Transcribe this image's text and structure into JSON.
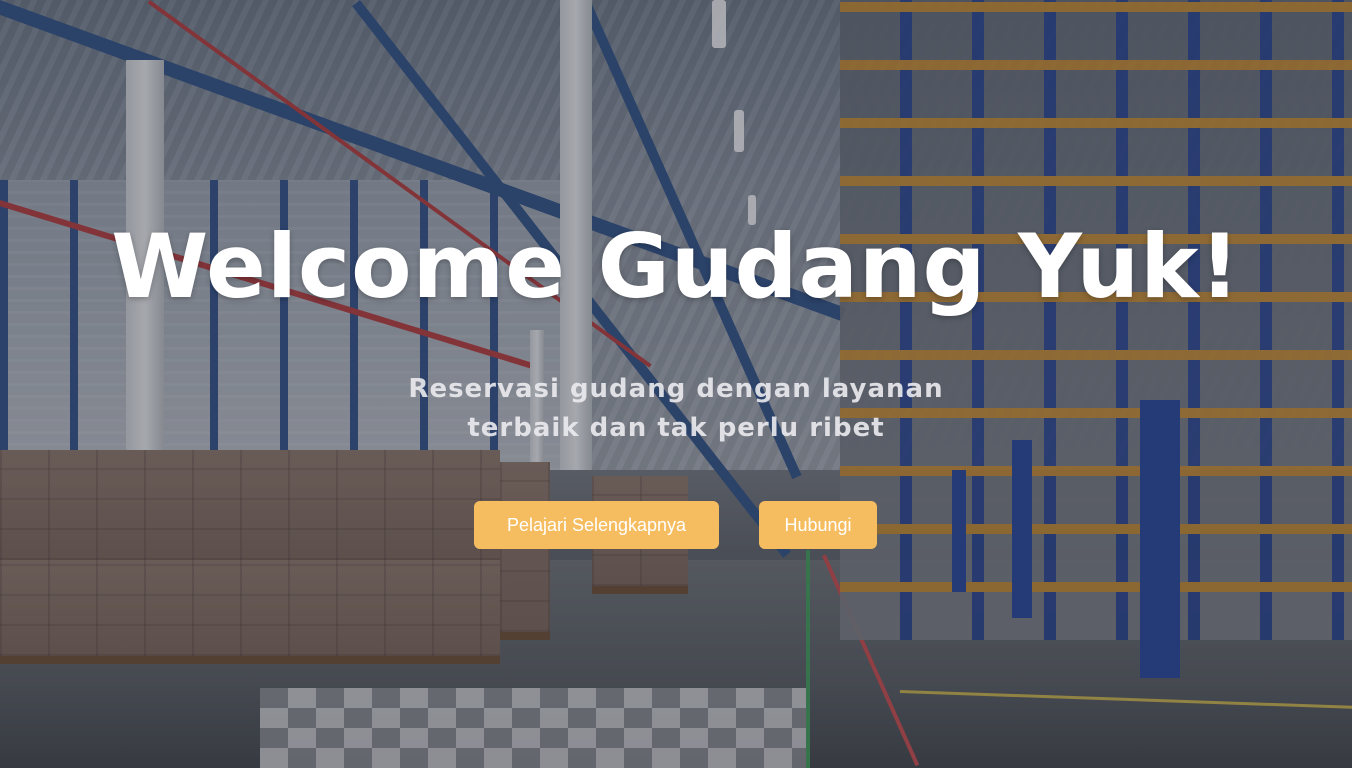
{
  "hero": {
    "title": "Welcome Gudang Yuk!",
    "subtitle_line1": "Reservasi gudang dengan layanan",
    "subtitle_line2": "terbaik dan tak perlu ribet",
    "primary_button": "Pelajari Selengkapnya",
    "secondary_button": "Hubungi",
    "background_image": "warehouse interior with pallets and shelving racks"
  },
  "colors": {
    "button": "#f6bd60",
    "title": "#ffffff",
    "overlay": "rgba(40,44,56,0.35)"
  }
}
